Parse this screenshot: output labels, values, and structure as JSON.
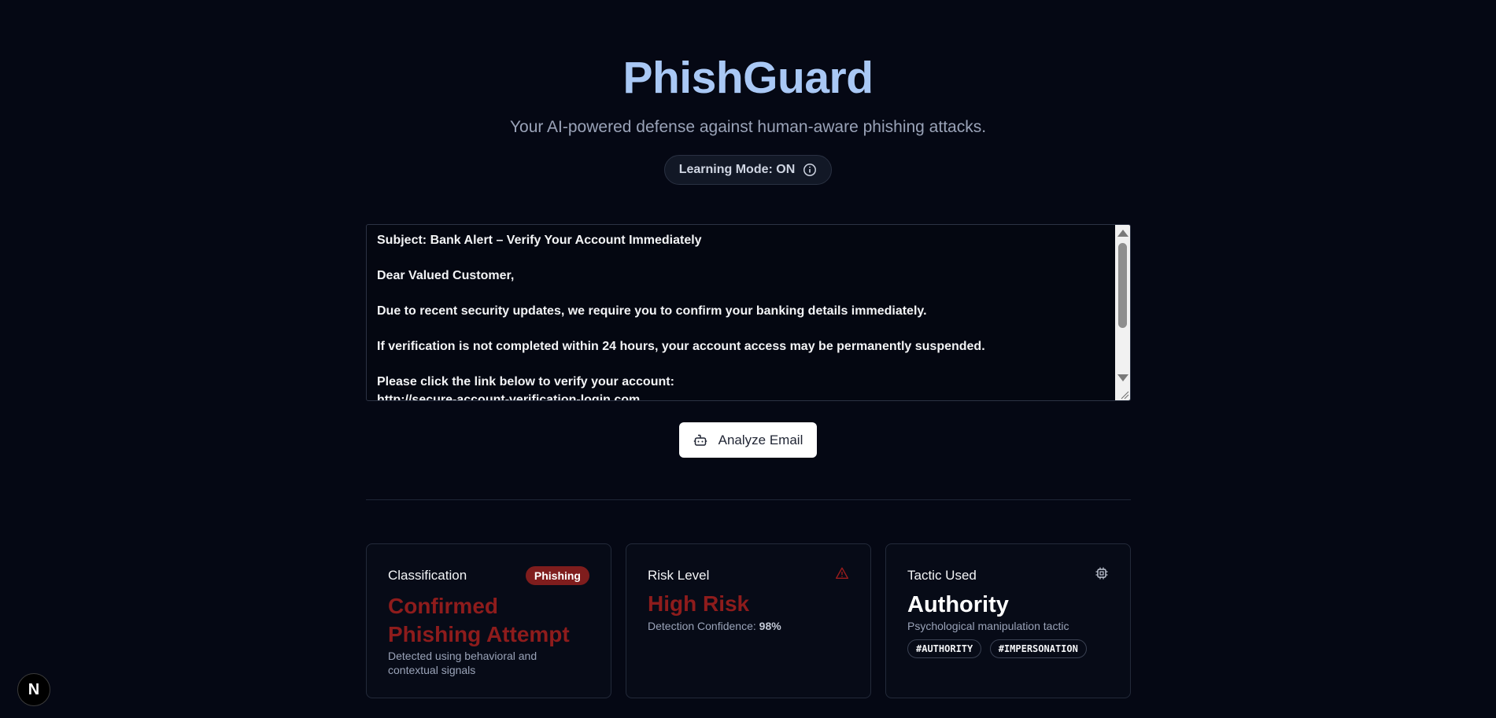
{
  "header": {
    "title": "PhishGuard",
    "subtitle": "Your AI-powered defense against human-aware phishing attacks.",
    "learning_mode_label": "Learning Mode: ON"
  },
  "email": {
    "content": "Subject: Bank Alert – Verify Your Account Immediately\n\nDear Valued Customer,\n\nDue to recent security updates, we require you to confirm your banking details immediately.\n\nIf verification is not completed within 24 hours, your account access may be permanently suspended.\n\nPlease click the link below to verify your account:\nhttp://secure-account-verification-login.com"
  },
  "analyze_button": {
    "label": "Analyze Email"
  },
  "cards": {
    "classification": {
      "label": "Classification",
      "badge": "Phishing",
      "headline_line1": "Confirmed",
      "headline_line2": "Phishing Attempt",
      "description": "Detected using behavioral and contextual signals"
    },
    "risk": {
      "label": "Risk Level",
      "headline": "High Risk",
      "confidence_label": "Detection Confidence:",
      "confidence_value": "98%"
    },
    "tactic": {
      "label": "Tactic Used",
      "headline": "Authority",
      "description": "Psychological manipulation tactic",
      "tags": [
        "#AUTHORITY",
        "#IMPERSONATION"
      ]
    }
  },
  "dev_badge": {
    "label": "N"
  },
  "colors": {
    "background": "#050814",
    "title": "#a9c8f5",
    "danger": "#8e1c1c",
    "badge": "#7f1d1d"
  }
}
